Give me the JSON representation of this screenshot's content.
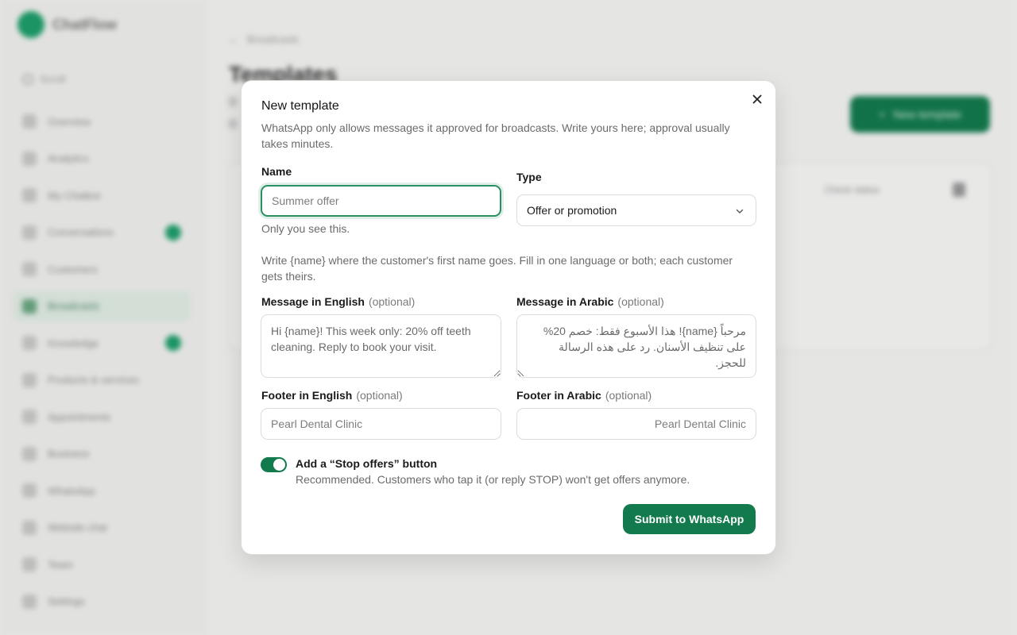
{
  "background": {
    "app_name": "ChatFlow",
    "search_label": "Scroll",
    "nav_items": [
      {
        "label": "Overview"
      },
      {
        "label": "Analytics"
      },
      {
        "label": "My Chatbot"
      },
      {
        "label": "Conversations"
      },
      {
        "label": "Customers"
      },
      {
        "label": "Broadcasts"
      },
      {
        "label": "Knowledge"
      },
      {
        "label": "Products & services"
      },
      {
        "label": "Appointments"
      },
      {
        "label": "Business"
      },
      {
        "label": "WhatsApp"
      },
      {
        "label": "Website chat"
      },
      {
        "label": "Team"
      },
      {
        "label": "Settings"
      }
    ],
    "back_link": "Broadcasts",
    "page_title": "Templates",
    "new_button": "New template",
    "card_action": "Check status"
  },
  "modal": {
    "title": "New template",
    "description": "WhatsApp only allows messages it approved for broadcasts. Write yours here; approval usually takes minutes.",
    "name_label": "Name",
    "name_placeholder": "Summer offer",
    "name_hint": "Only you see this.",
    "type_label": "Type",
    "type_value": "Offer or promotion",
    "instructions": "Write {name} where the customer's first name goes. Fill in one language or both; each customer gets theirs.",
    "optional_text": "(optional)",
    "msg_en_label": "Message in English",
    "msg_en_value": "Hi {name}! This week only: 20% off teeth cleaning. Reply to book your visit.",
    "msg_ar_label": "Message in Arabic",
    "msg_ar_value": "مرحباً {name}! هذا الأسبوع فقط: خصم 20% على تنظيف الأسنان. رد على هذه الرسالة للحجز.",
    "footer_en_label": "Footer in English",
    "footer_en_placeholder": "Pearl Dental Clinic",
    "footer_ar_label": "Footer in Arabic",
    "footer_ar_placeholder": "Pearl Dental Clinic",
    "stop_toggle_label": "Add a “Stop offers” button",
    "stop_toggle_on": true,
    "stop_toggle_hint": "Recommended. Customers who tap it (or reply STOP) won't get offers anymore.",
    "submit_label": "Submit to WhatsApp"
  },
  "colors": {
    "brand_green": "#137a4d",
    "focus_ring": "#2b8f62"
  },
  "icons": [
    "close-icon",
    "chevron-down-icon",
    "search-icon",
    "plus-icon",
    "trash-icon",
    "back-arrow-icon"
  ]
}
